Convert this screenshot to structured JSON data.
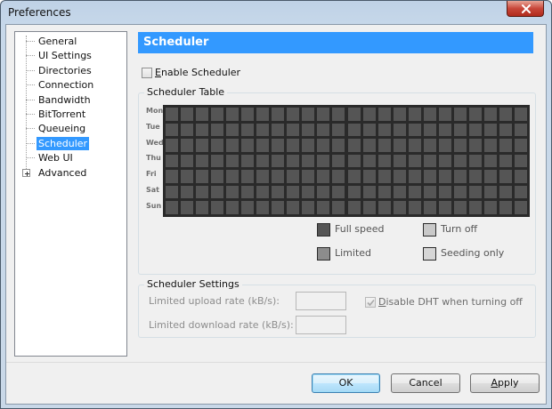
{
  "window": {
    "title": "Preferences",
    "close_label": "×"
  },
  "sidebar": {
    "items": [
      {
        "label": "General"
      },
      {
        "label": "UI Settings"
      },
      {
        "label": "Directories"
      },
      {
        "label": "Connection"
      },
      {
        "label": "Bandwidth"
      },
      {
        "label": "BitTorrent"
      },
      {
        "label": "Queueing"
      },
      {
        "label": "Scheduler",
        "selected": true
      },
      {
        "label": "Web UI"
      },
      {
        "label": "Advanced",
        "expandable": true
      }
    ]
  },
  "main": {
    "header": "Scheduler",
    "enable_scheduler": {
      "label_first": "E",
      "label_rest": "nable Scheduler",
      "checked": false
    },
    "scheduler_table": {
      "title": "Scheduler Table",
      "days": [
        "Mon",
        "Tue",
        "Wed",
        "Thu",
        "Fri",
        "Sat",
        "Sun"
      ],
      "hours_per_day": 24,
      "legend": [
        {
          "label": "Full speed",
          "color": "#555555"
        },
        {
          "label": "Turn off",
          "color": "#c9c9c9"
        },
        {
          "label": "Limited",
          "color": "#8c8c8c"
        },
        {
          "label": "Seeding only",
          "color": "#d6d6d6"
        }
      ]
    },
    "scheduler_settings": {
      "title": "Scheduler Settings",
      "upload_label": "Limited upload rate (kB/s):",
      "upload_value": "",
      "download_label": "Limited download rate (kB/s):",
      "download_value": "",
      "disable_dht": {
        "label_first": "D",
        "label_rest": "isable DHT when turning off",
        "checked": true
      }
    }
  },
  "buttons": {
    "ok": "OK",
    "cancel": "Cancel",
    "apply_first": "A",
    "apply_rest": "pply"
  },
  "colors": {
    "accent": "#3399ff",
    "grid_border": "#2a2a2a",
    "cell_full_speed": "#555555"
  }
}
